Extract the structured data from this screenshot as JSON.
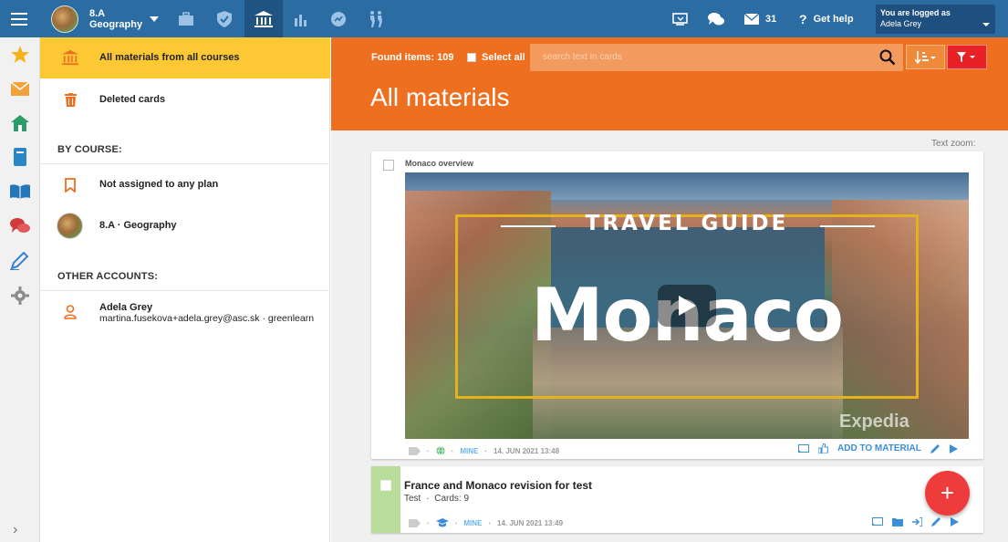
{
  "topbar": {
    "course_class": "8.A",
    "course_subject": "Geography",
    "messages_count": "31",
    "help_label": "Get help",
    "login_caption": "You are logged as",
    "login_user": "Adela Grey"
  },
  "sidebar": {
    "items": [
      {
        "label": "All materials from all courses"
      },
      {
        "label": "Deleted cards"
      }
    ],
    "by_course_heading": "BY COURSE:",
    "course_items": [
      {
        "label": "Not assigned to any plan"
      },
      {
        "label": "8.A · Geography"
      }
    ],
    "other_accounts_heading": "OTHER ACCOUNTS:",
    "account": {
      "name": "Adela Grey",
      "detail": "martina.fusekova+adela.grey@asc.sk · greenlearn"
    }
  },
  "main": {
    "found_items": "Found items: 109",
    "select_all": "Select all",
    "search_placeholder": "search text in cards",
    "page_title": "All materials",
    "text_zoom": "Text zoom:",
    "cards": [
      {
        "title": "Monaco overview",
        "video_overlay_top": "TRAVEL GUIDE",
        "video_overlay_main": "Monaco",
        "watermark": "Expedia",
        "owner": "MINE",
        "date": "14. JUN 2021 13:48",
        "action_add": "ADD TO MATERIAL"
      },
      {
        "title": "France and Monaco revision for test",
        "type": "Test",
        "cards_count": "Cards: 9",
        "owner": "MINE",
        "date": "14. JUN 2021 13:49"
      }
    ]
  },
  "colors": {
    "topbar": "#2b6ca3",
    "accent_orange": "#ee6f1f",
    "active_item": "#fcc934",
    "filter_red": "#e82127",
    "fab_red": "#ee3b3b",
    "test_stripe": "#b9dd9a"
  }
}
